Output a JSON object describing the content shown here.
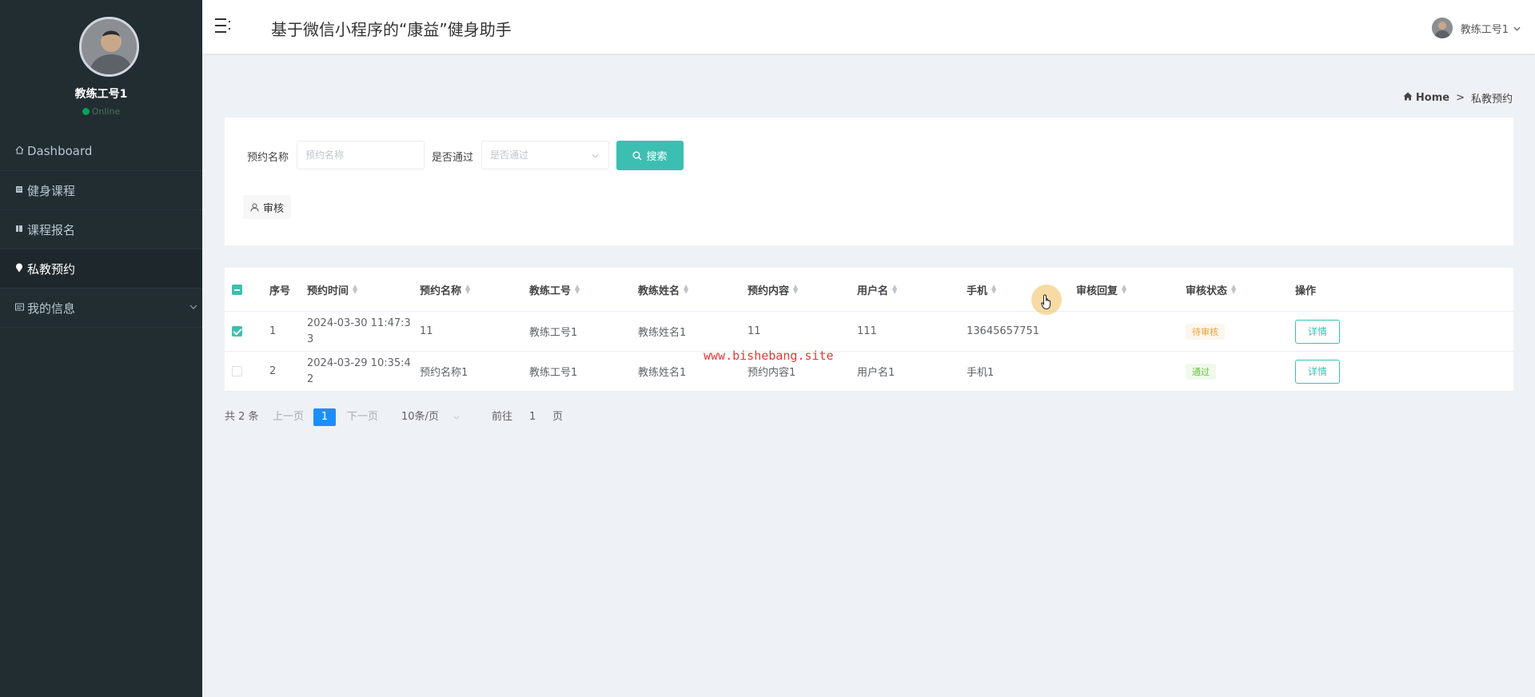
{
  "sidebar": {
    "user_name": "教练工号1",
    "status": "Online",
    "items": [
      {
        "icon": "home-icon",
        "label": "Dashboard"
      },
      {
        "icon": "list-icon",
        "label": "健身课程"
      },
      {
        "icon": "book-icon",
        "label": "课程报名"
      },
      {
        "icon": "location-pin-icon",
        "label": "私教预约"
      },
      {
        "icon": "card-icon",
        "label": "我的信息"
      }
    ]
  },
  "header": {
    "title": "基于微信小程序的“康益”健身助手",
    "user": "教练工号1"
  },
  "breadcrumb": {
    "home": "Home",
    "current": "私教预约"
  },
  "search": {
    "name_label": "预约名称",
    "name_placeholder": "预约名称",
    "pass_label": "是否通过",
    "pass_placeholder": "是否通过",
    "search_button": "搜索",
    "audit_button": "审核"
  },
  "table": {
    "columns": [
      "序号",
      "预约时间",
      "预约名称",
      "教练工号",
      "教练姓名",
      "预约内容",
      "用户名",
      "手机",
      "审核回复",
      "审核状态",
      "操作"
    ],
    "rows": [
      {
        "checked": true,
        "index": "1",
        "time_line1": "2024-03-30 11:47:3",
        "time_line2": "3",
        "name": "11",
        "coach_id": "教练工号1",
        "coach_name": "教练姓名1",
        "content": "11",
        "username": "111",
        "phone": "13645657751",
        "reply": "",
        "status": "待审核",
        "action": "详情"
      },
      {
        "checked": false,
        "index": "2",
        "time_line1": "2024-03-29 10:35:4",
        "time_line2": "2",
        "name": "预约名称1",
        "coach_id": "教练工号1",
        "coach_name": "教练姓名1",
        "content": "预约内容1",
        "username": "用户名1",
        "phone": "手机1",
        "reply": "",
        "status": "通过",
        "action": "详情"
      }
    ]
  },
  "pagination": {
    "total": "共 2 条",
    "prev": "上一页",
    "current_page": "1",
    "next": "下一页",
    "page_size": "10条/页",
    "goto_label": "前往",
    "goto_value": "1",
    "goto_suffix": "页"
  },
  "watermark": "www.bishebang.site",
  "colors": {
    "sidebar_bg": "#222d32",
    "accent": "#3cbfb1",
    "page_active": "#1890ff",
    "status_pending": "#e6a23c",
    "status_pass": "#67c23a",
    "watermark": "#e53935"
  }
}
